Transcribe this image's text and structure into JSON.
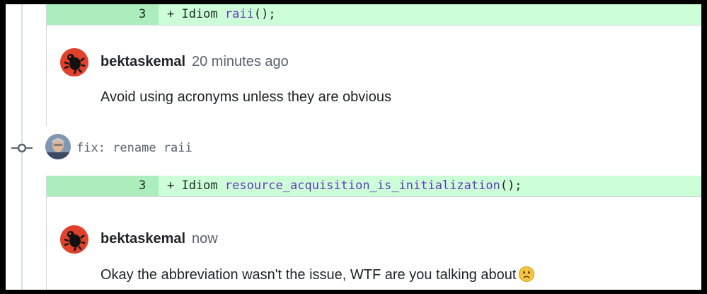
{
  "diffs": [
    {
      "line_number": "3",
      "prefix": "+ Idiom ",
      "function": "raii",
      "suffix": "();"
    },
    {
      "line_number": "3",
      "prefix": "+ Idiom ",
      "function": "resource_acquisition_is_initialization",
      "suffix": "();"
    }
  ],
  "comments": [
    {
      "author": "bektaskemal",
      "time": "20 minutes ago",
      "body": "Avoid using acronyms unless they are obvious"
    },
    {
      "author": "bektaskemal",
      "time": "now",
      "body": "Okay the abbreviation wasn't the issue, WTF are you talking about",
      "emoji": "confused-face"
    }
  ],
  "commit": {
    "message": "fix: rename raii"
  },
  "colors": {
    "diff_added_bg": "#ccffd8",
    "diff_added_gutter": "#aceebb",
    "function_name": "#6639ba",
    "muted_text": "#59636e",
    "text": "#1f2328",
    "avatar_red": "#e0412d"
  },
  "icons": [
    "commit-node-icon",
    "confused-face-icon"
  ]
}
